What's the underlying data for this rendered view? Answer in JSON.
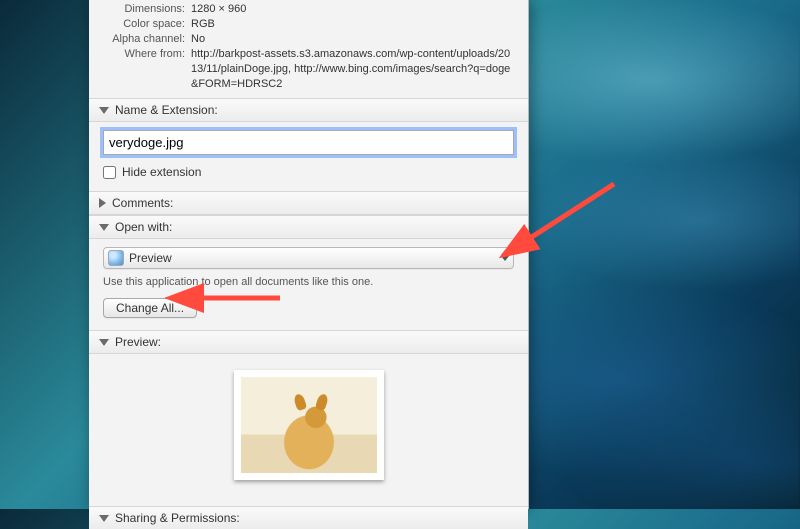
{
  "info": {
    "dimensions_label": "Dimensions:",
    "dimensions_value": "1280 × 960",
    "colorspace_label": "Color space:",
    "colorspace_value": "RGB",
    "alpha_label": "Alpha channel:",
    "alpha_value": "No",
    "where_label": "Where from:",
    "where_value": "http://barkpost-assets.s3.amazonaws.com/wp-content/uploads/2013/11/plainDoge.jpg, http://www.bing.com/images/search?q=doge&FORM=HDRSC2"
  },
  "sections": {
    "name_ext": "Name & Extension:",
    "comments": "Comments:",
    "open_with": "Open with:",
    "preview": "Preview:",
    "sharing": "Sharing & Permissions:"
  },
  "name_ext": {
    "filename_value": "verydoge.jpg",
    "hide_ext_label": "Hide extension",
    "hide_ext_checked": false
  },
  "open_with": {
    "selected_app": "Preview",
    "helper_text": "Use this application to open all documents like this one.",
    "change_all_label": "Change All..."
  }
}
